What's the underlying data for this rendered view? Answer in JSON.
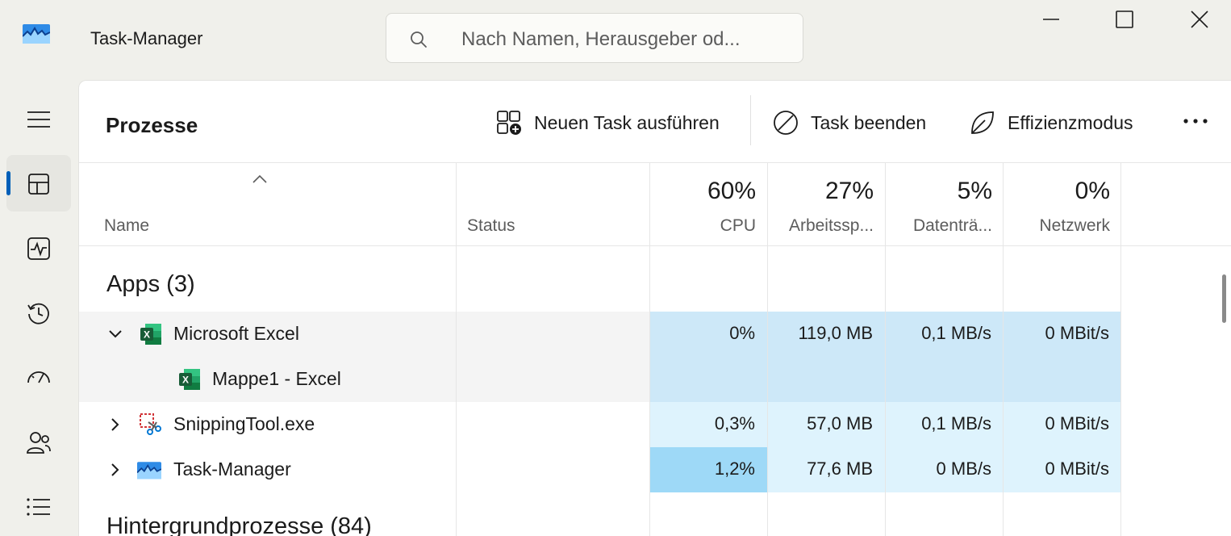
{
  "window": {
    "title": "Task-Manager",
    "search_placeholder": "Nach Namen, Herausgeber od..."
  },
  "nav": {
    "items": [
      {
        "name": "hamburger-menu"
      },
      {
        "name": "processes",
        "active": true
      },
      {
        "name": "performance"
      },
      {
        "name": "app-history"
      },
      {
        "name": "startup-apps"
      },
      {
        "name": "users"
      },
      {
        "name": "details"
      }
    ]
  },
  "toolbar": {
    "page_title": "Prozesse",
    "new_task": "Neuen Task ausführen",
    "end_task": "Task beenden",
    "efficiency": "Effizienzmodus"
  },
  "columns": {
    "name": "Name",
    "status": "Status",
    "cpu": {
      "pct": "60%",
      "label": "CPU"
    },
    "memory": {
      "pct": "27%",
      "label": "Arbeitssp..."
    },
    "disk": {
      "pct": "5%",
      "label": "Datenträ..."
    },
    "network": {
      "pct": "0%",
      "label": "Netzwerk"
    }
  },
  "groups": {
    "apps": "Apps (3)",
    "background": "Hintergrundprozesse (84)"
  },
  "rows": [
    {
      "name": "Microsoft Excel",
      "cpu": "0%",
      "memory": "119,0 MB",
      "disk": "0,1 MB/s",
      "network": "0 MBit/s"
    },
    {
      "name": "Mappe1 - Excel"
    },
    {
      "name": "SnippingTool.exe",
      "cpu": "0,3%",
      "memory": "57,0 MB",
      "disk": "0,1 MB/s",
      "network": "0 MBit/s"
    },
    {
      "name": "Task-Manager",
      "cpu": "1,2%",
      "memory": "77,6 MB",
      "disk": "0 MB/s",
      "network": "0 MBit/s"
    }
  ],
  "colors": {
    "accent": "#005fb8",
    "heat_light": "#def3fd",
    "heat_medium": "#cde8f8",
    "heat_strong": "#9ed9f7",
    "selected_row": "#f4f4f4"
  }
}
